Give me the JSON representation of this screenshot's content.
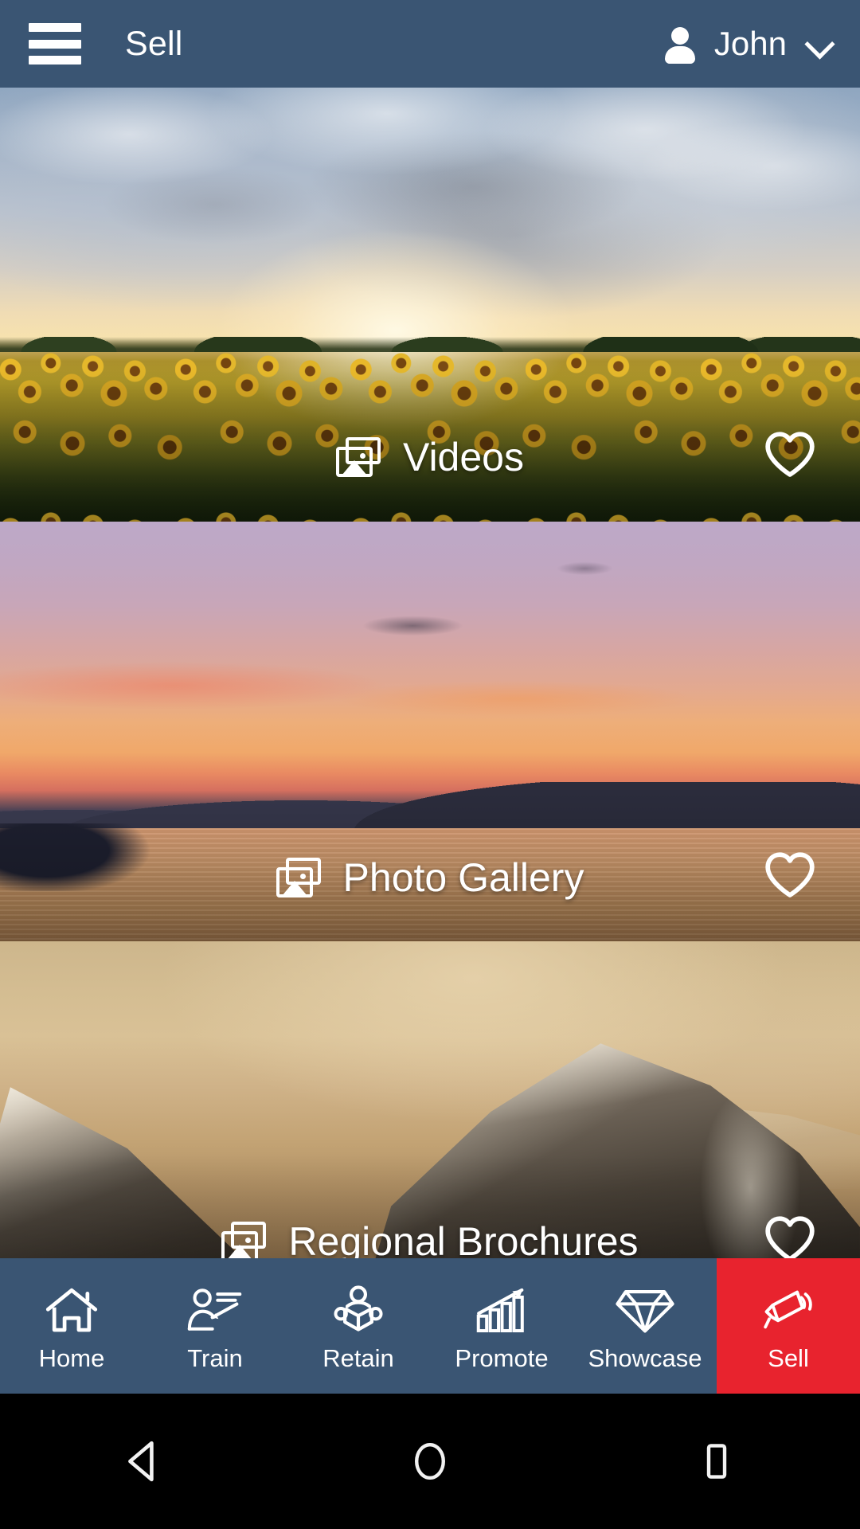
{
  "header": {
    "menu_icon": "hamburger-menu-icon",
    "title": "Sell",
    "user_icon": "person-icon",
    "user_name": "John",
    "dropdown_icon": "chevron-down-icon"
  },
  "colors": {
    "header_bg": "#3a5573",
    "nav_bg": "#3a5573",
    "active_tab_bg": "#e8232e",
    "text_on_dark": "#ffffff",
    "system_bar_bg": "#000000"
  },
  "cards": [
    {
      "title": "Videos",
      "media_icon": "photo-stack-icon",
      "favorite_icon": "heart-outline-icon",
      "favorited": false,
      "image_description": "Sunflower field under dramatic sunset sky"
    },
    {
      "title": "Photo Gallery",
      "media_icon": "photo-stack-icon",
      "favorite_icon": "heart-outline-icon",
      "favorited": false,
      "image_description": "Lake at sunset with purple and orange sky and dark hills"
    },
    {
      "title": "Regional Brochures",
      "media_icon": "photo-stack-icon",
      "favorite_icon": "heart-outline-icon",
      "favorited": false,
      "image_description": "Snow covered mountain peak in golden light"
    }
  ],
  "bottom_nav": {
    "items": [
      {
        "label": "Home",
        "icon": "house-icon",
        "active": false
      },
      {
        "label": "Train",
        "icon": "presenter-icon",
        "active": false
      },
      {
        "label": "Retain",
        "icon": "person-reading-icon",
        "active": false
      },
      {
        "label": "Promote",
        "icon": "growth-chart-icon",
        "active": false
      },
      {
        "label": "Showcase",
        "icon": "diamond-icon",
        "active": false
      },
      {
        "label": "Sell",
        "icon": "megaphone-icon",
        "active": true
      }
    ]
  },
  "system_nav": {
    "back": "back-triangle-icon",
    "home": "home-circle-icon",
    "recents": "recents-square-icon"
  }
}
